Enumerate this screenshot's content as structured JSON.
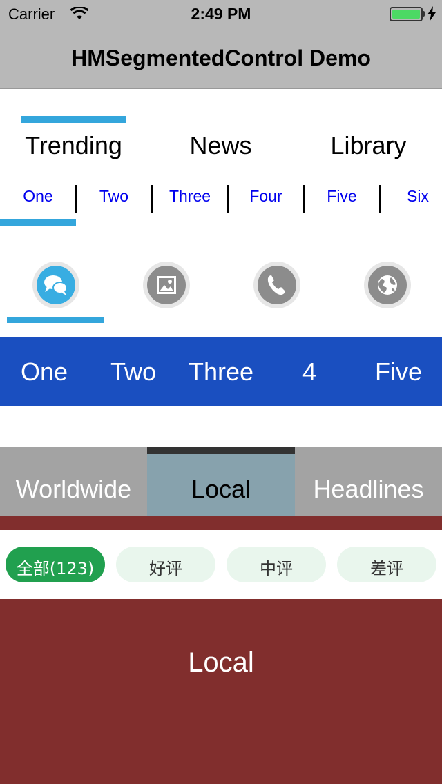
{
  "status_bar": {
    "carrier": "Carrier",
    "time": "2:49 PM"
  },
  "nav": {
    "title": "HMSegmentedControl Demo"
  },
  "segmented1": {
    "items": [
      "Trending",
      "News",
      "Library"
    ],
    "selected_index": 0,
    "indicator_color": "#34a6dc"
  },
  "segmented2": {
    "items": [
      "One",
      "Two",
      "Three",
      "Four",
      "Five",
      "Six"
    ],
    "selected_index": 0,
    "text_color": "#0000ee"
  },
  "segmented3": {
    "icons": [
      "chat-icon",
      "image-icon",
      "phone-icon",
      "globe-icon"
    ],
    "selected_index": 0
  },
  "segmented4": {
    "items": [
      "One",
      "Two",
      "Three",
      "4",
      "Five"
    ],
    "background": "#1a4fc0"
  },
  "segmented5": {
    "items": [
      "Worldwide",
      "Local",
      "Headlines"
    ],
    "selected_index": 1
  },
  "filters": {
    "items": [
      "全部(123)",
      "好评",
      "中评",
      "差评"
    ],
    "selected_index": 0,
    "active_color": "#21a04f"
  },
  "page": {
    "label": "Local",
    "background": "#812e2d"
  }
}
